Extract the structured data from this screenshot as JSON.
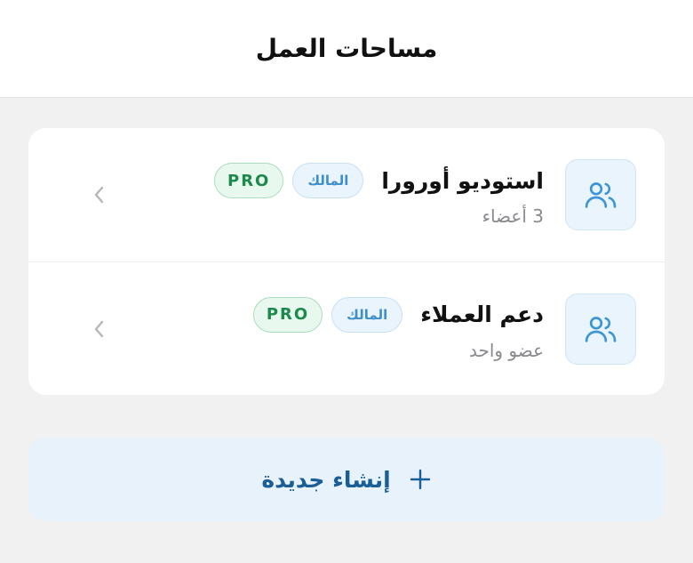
{
  "header": {
    "title": "مساحات العمل"
  },
  "workspaces": [
    {
      "name": "استوديو أورورا",
      "role": "المالك",
      "plan": "PRO",
      "members": "3 أعضاء",
      "icon": "users-icon"
    },
    {
      "name": "دعم العملاء",
      "role": "المالك",
      "plan": "PRO",
      "members": "عضو واحد",
      "icon": "users-icon"
    }
  ],
  "create": {
    "label": "إنشاء جديدة",
    "icon": "plus-icon"
  },
  "colors": {
    "accent": "#3d8fce",
    "create_text": "#1a5e97",
    "pro_green": "#1b8a4c",
    "background": "#f1f1f2"
  }
}
